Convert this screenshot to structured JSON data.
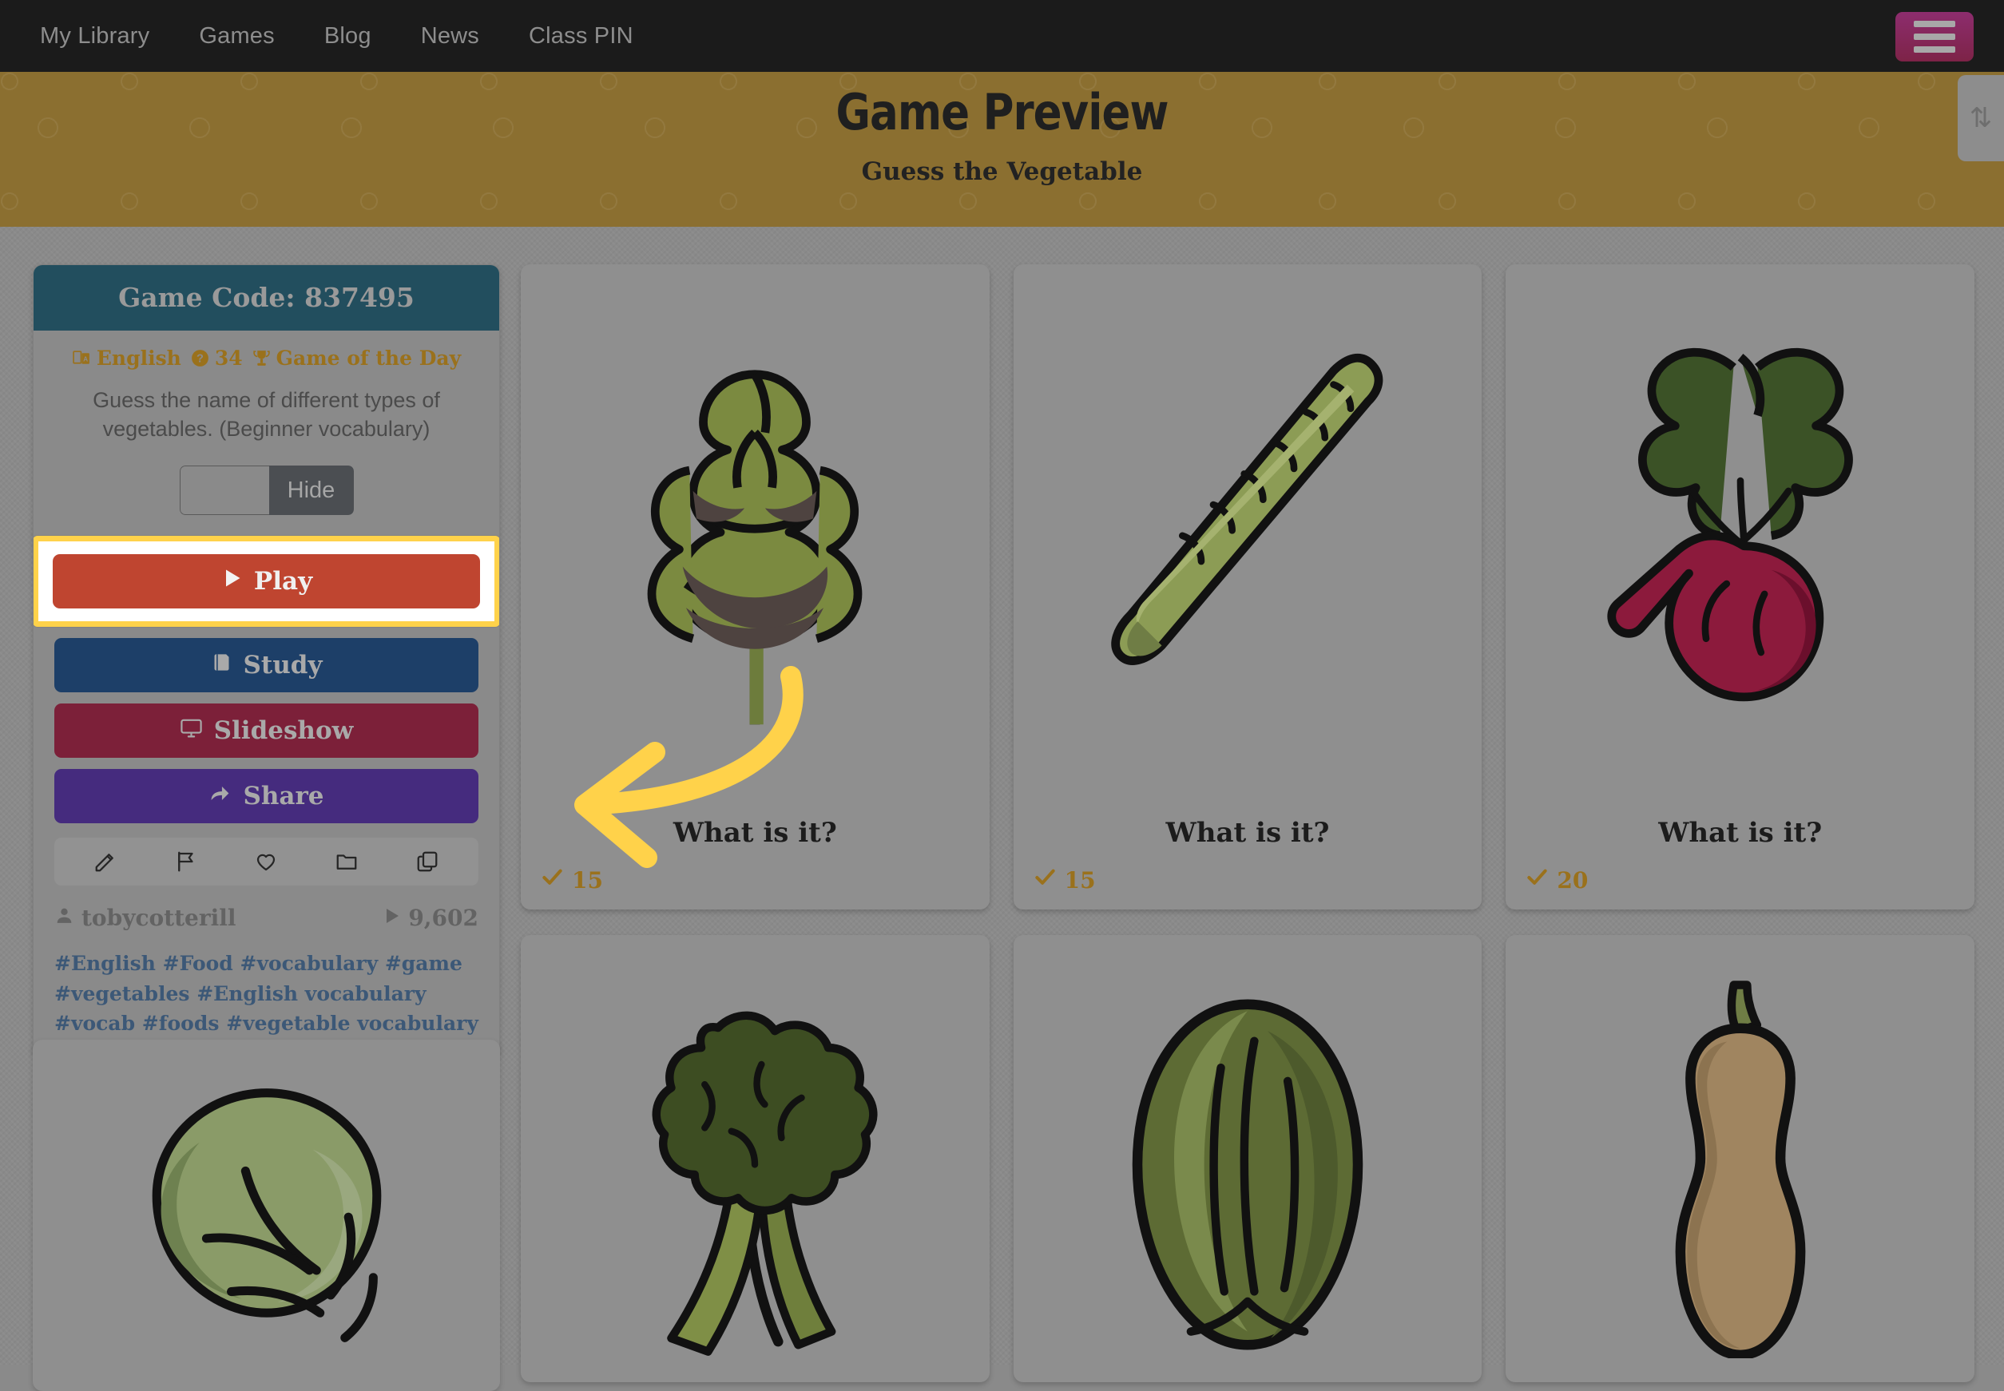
{
  "nav": {
    "links": [
      {
        "label": "My Library",
        "name": "nav-my-library"
      },
      {
        "label": "Games",
        "name": "nav-games"
      },
      {
        "label": "Blog",
        "name": "nav-blog"
      },
      {
        "label": "News",
        "name": "nav-news"
      },
      {
        "label": "Class PIN",
        "name": "nav-class-pin"
      }
    ],
    "menu_icon": "hamburger-icon"
  },
  "banner": {
    "title": "Game Preview",
    "subtitle": "Guess the Vegetable",
    "background_color": "#8b6f30"
  },
  "sidebar": {
    "game_code_label": "Game Code: 837495",
    "header_color": "#224e5e",
    "meta": [
      {
        "icon": "language-icon",
        "label": "English"
      },
      {
        "icon": "question-circle-icon",
        "label": "34"
      },
      {
        "icon": "trophy-icon",
        "label": "Game of the Day"
      }
    ],
    "meta_color": "#9a711c",
    "description": "Guess the name of different types of vegetables. (Beginner vocabulary)",
    "toggle": {
      "left_label": "",
      "right_label": "Hide",
      "active": "Hide"
    },
    "buttons": [
      {
        "label": "Play",
        "icon": "play-icon",
        "color": "#bf4530",
        "name": "play-button",
        "highlighted": true
      },
      {
        "label": "Study",
        "icon": "book-icon",
        "color": "#1d3f68",
        "name": "study-button",
        "highlighted": false
      },
      {
        "label": "Slideshow",
        "icon": "monitor-icon",
        "color": "#7c2039",
        "name": "slideshow-button",
        "highlighted": false
      },
      {
        "label": "Share",
        "icon": "share-arrow-icon",
        "color": "#452b7e",
        "name": "share-button",
        "highlighted": false
      }
    ],
    "action_icons": [
      {
        "name": "pencil-icon"
      },
      {
        "name": "flag-icon"
      },
      {
        "name": "heart-icon"
      },
      {
        "name": "folder-icon"
      },
      {
        "name": "copy-icon"
      }
    ],
    "author": {
      "icon": "user-icon",
      "name": "tobycotterill"
    },
    "plays": {
      "icon": "play-icon",
      "count": "9,602"
    },
    "tags": [
      "#English",
      "#Food",
      "#vocabulary",
      "#game",
      "#vegetables",
      "#English vocabulary",
      "#vocab",
      "#foods",
      "#vegetable vocabulary"
    ],
    "tag_color": "#3c5877"
  },
  "cards": {
    "caption": "What is it?",
    "count_icon": "check-icon",
    "count_color": "#9a711c",
    "row1": [
      {
        "name": "card-artichoke",
        "subject": "artichoke",
        "caption": "What is it?",
        "count": "15"
      },
      {
        "name": "card-asparagus",
        "subject": "asparagus",
        "caption": "What is it?",
        "count": "15"
      },
      {
        "name": "card-beetroot",
        "subject": "beetroot",
        "caption": "What is it?",
        "count": "20"
      }
    ],
    "row2": [
      {
        "name": "card-broccoli",
        "subject": "broccoli"
      },
      {
        "name": "card-cabbage",
        "subject": "cabbage"
      },
      {
        "name": "card-butternut-squash",
        "subject": "butternut squash"
      }
    ],
    "sidebar_extra": {
      "name": "card-lettuce",
      "subject": "lettuce"
    }
  },
  "annotation": {
    "arrow_color": "#ffd24a",
    "points_to": "play-button"
  },
  "scroll_badge": {
    "label": "⇅"
  }
}
